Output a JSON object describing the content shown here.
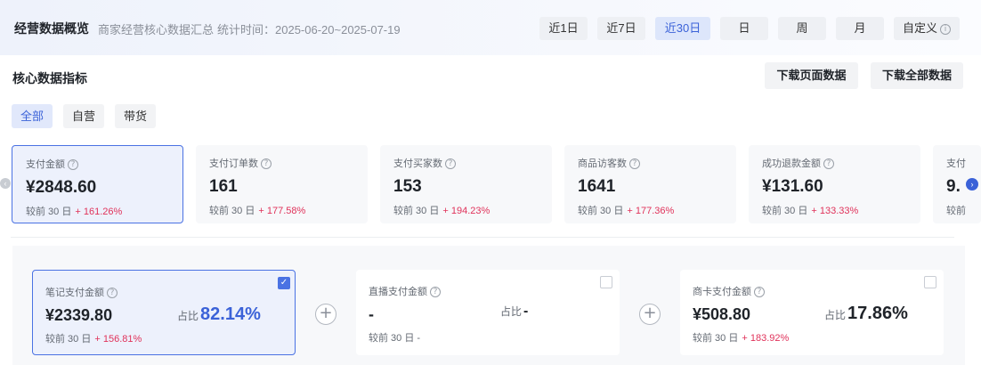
{
  "header": {
    "title": "经营数据概览",
    "subtitle": "商家经营核心数据汇总",
    "stat_time": "统计时间：2025-06-20~2025-07-19",
    "ranges": [
      {
        "label": "近1日",
        "active": false
      },
      {
        "label": "近7日",
        "active": false
      },
      {
        "label": "近30日",
        "active": true
      },
      {
        "label": "日",
        "active": false
      },
      {
        "label": "周",
        "active": false
      },
      {
        "label": "月",
        "active": false
      },
      {
        "label": "自定义",
        "active": false
      }
    ]
  },
  "core": {
    "title": "核心数据指标",
    "download_page": "下载页面数据",
    "download_all": "下载全部数据",
    "filters": [
      {
        "label": "全部",
        "active": true
      },
      {
        "label": "自营",
        "active": false
      },
      {
        "label": "带货",
        "active": false
      }
    ]
  },
  "metrics": [
    {
      "label": "支付金额",
      "value": "¥2848.60",
      "compare": "较前 30 日",
      "change": "+ 161.26%",
      "selected": true
    },
    {
      "label": "支付订单数",
      "value": "161",
      "compare": "较前 30 日",
      "change": "+ 177.58%",
      "selected": false
    },
    {
      "label": "支付买家数",
      "value": "153",
      "compare": "较前 30 日",
      "change": "+ 194.23%",
      "selected": false
    },
    {
      "label": "商品访客数",
      "value": "1641",
      "compare": "较前 30 日",
      "change": "+ 177.36%",
      "selected": false
    },
    {
      "label": "成功退款金额",
      "value": "¥131.60",
      "compare": "较前 30 日",
      "change": "+ 133.33%",
      "selected": false
    },
    {
      "label": "支付",
      "value": "9.",
      "compare": "较前",
      "change": "",
      "selected": false
    }
  ],
  "breakdown": {
    "ratio_label": "占比",
    "items": [
      {
        "label": "笔记支付金额",
        "value": "¥2339.80",
        "ratio": "82.14%",
        "compare": "较前 30 日",
        "change": "+ 156.81%",
        "checked": true
      },
      {
        "label": "直播支付金额",
        "value": "-",
        "ratio": "-",
        "compare": "较前 30 日",
        "change": "-",
        "checked": false
      },
      {
        "label": "商卡支付金额",
        "value": "¥508.80",
        "ratio": "17.86%",
        "compare": "较前 30 日",
        "change": "+ 183.92%",
        "checked": false
      }
    ]
  },
  "icons": {
    "info": "info-circle-icon",
    "plus": "plus-circle-icon",
    "check": "check-icon",
    "prev": "chevron-left-icon",
    "next": "chevron-right-icon"
  },
  "colors": {
    "accent": "#3b62d8",
    "increase": "#e0325a"
  }
}
